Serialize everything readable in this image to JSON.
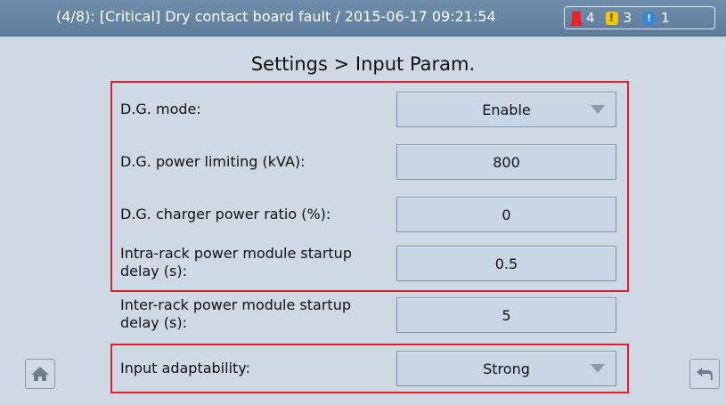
{
  "topbar": {
    "alarm_text": "(4/8): [Critical] Dry contact board fault / 2015-06-17 09:21:54",
    "counts": {
      "critical": "4",
      "major": "3",
      "minor": "1"
    },
    "icons": {
      "critical": "critical-alarm-icon",
      "major": "major-alarm-icon",
      "minor": "minor-alarm-icon"
    },
    "icon_glyphs": {
      "major": "!",
      "minor": "!"
    }
  },
  "page": {
    "title": "Settings > Input Param."
  },
  "params": [
    {
      "label_line1": "D.G. mode:",
      "label_line2": "",
      "value": "Enable",
      "type": "select"
    },
    {
      "label_line1": "D.G. power limiting (kVA):",
      "label_line2": "",
      "value": "800",
      "type": "input"
    },
    {
      "label_line1": "D.G. charger power ratio (%):",
      "label_line2": "",
      "value": "0",
      "type": "input"
    },
    {
      "label_line1": "Intra-rack power module startup",
      "label_line2": "delay (s):",
      "value": "0.5",
      "type": "input"
    },
    {
      "label_line1": "Inter-rack power module startup",
      "label_line2": "delay (s):",
      "value": "5",
      "type": "input"
    },
    {
      "label_line1": "Input adaptability:",
      "label_line2": "",
      "value": "Strong",
      "type": "select"
    }
  ],
  "nav": {
    "home_icon": "home-icon",
    "back_icon": "back-icon"
  },
  "colors": {
    "accent_red": "#e3202a",
    "topbar": "#6785a3",
    "background": "#cfd9e3"
  }
}
